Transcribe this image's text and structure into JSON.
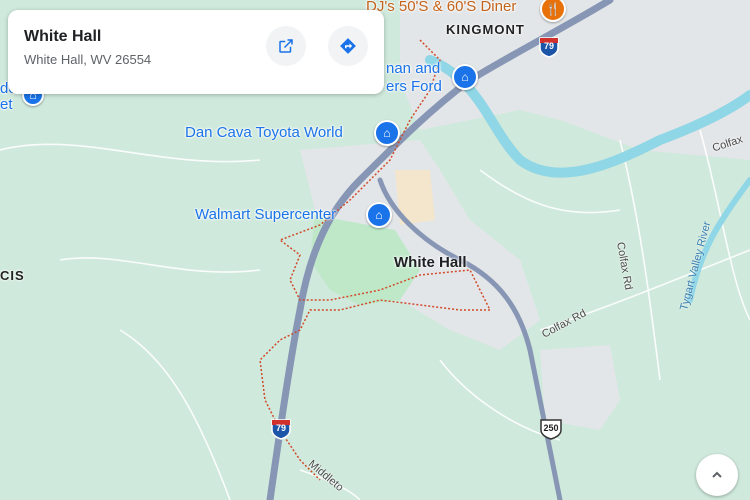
{
  "card": {
    "title": "White Hall",
    "subtitle": "White Hall, WV 26554",
    "icons": [
      "open-in-new-icon",
      "directions-icon"
    ]
  },
  "places": {
    "diner": "DJ's 50'S & 60'S Diner",
    "kingmont": "KINGMONT",
    "honda_line1": "nan and",
    "honda_line2": "ers Ford",
    "toyota": "Dan Cava Toyota World",
    "walmart": "Walmart Supercenter",
    "white_hall": "White Hall",
    "cis": "CIS",
    "de": "de",
    "et": "et"
  },
  "roads": {
    "colfax": "Colfax",
    "colfax_rd": "Colfax Rd",
    "colfax_rd_vertical": "Colfax Rd",
    "middleto": "Middleto"
  },
  "water": {
    "tygart": "Tygart Valley River"
  },
  "shields": {
    "i79_top": "79",
    "i79_bottom": "79",
    "us250": "250"
  },
  "colors": {
    "land": "#cfe9dc",
    "urban": "#e3e6e8",
    "park": "#bfe8c9",
    "highway": "#8796b4",
    "river": "#8fd6e6",
    "boundary": "#d24a2a",
    "accent": "#1a73e8",
    "food": "#e8710a"
  },
  "icons": {
    "poi_shop": "shopping-bag-icon",
    "poi_food": "restaurant-icon",
    "zoom": "zoom-control-icon"
  }
}
